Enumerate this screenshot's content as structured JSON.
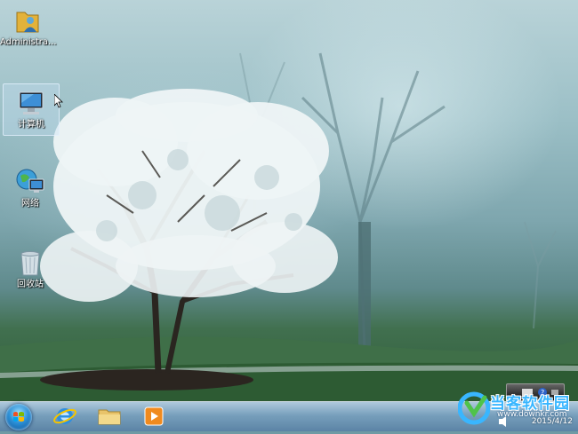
{
  "desktop": {
    "icons": [
      {
        "label": "Administra...",
        "icon": "user-folder-icon"
      },
      {
        "label": "计算机",
        "icon": "computer-icon",
        "selected": true
      },
      {
        "label": "网络",
        "icon": "network-icon"
      },
      {
        "label": "回收站",
        "icon": "recycle-bin-icon"
      }
    ]
  },
  "taskbar": {
    "items": [
      {
        "icon": "start-orb-icon"
      },
      {
        "icon": "internet-explorer-icon"
      },
      {
        "icon": "file-explorer-icon"
      },
      {
        "icon": "media-player-icon"
      }
    ],
    "tray": {
      "date": "2015/4/12"
    }
  },
  "watermark": {
    "title": "当客软件园",
    "url": "www.downkr.com"
  },
  "colors": {
    "taskbar": "#7aa0c0",
    "selection": "#c8e1f5",
    "watermark": "#39b6ff"
  }
}
